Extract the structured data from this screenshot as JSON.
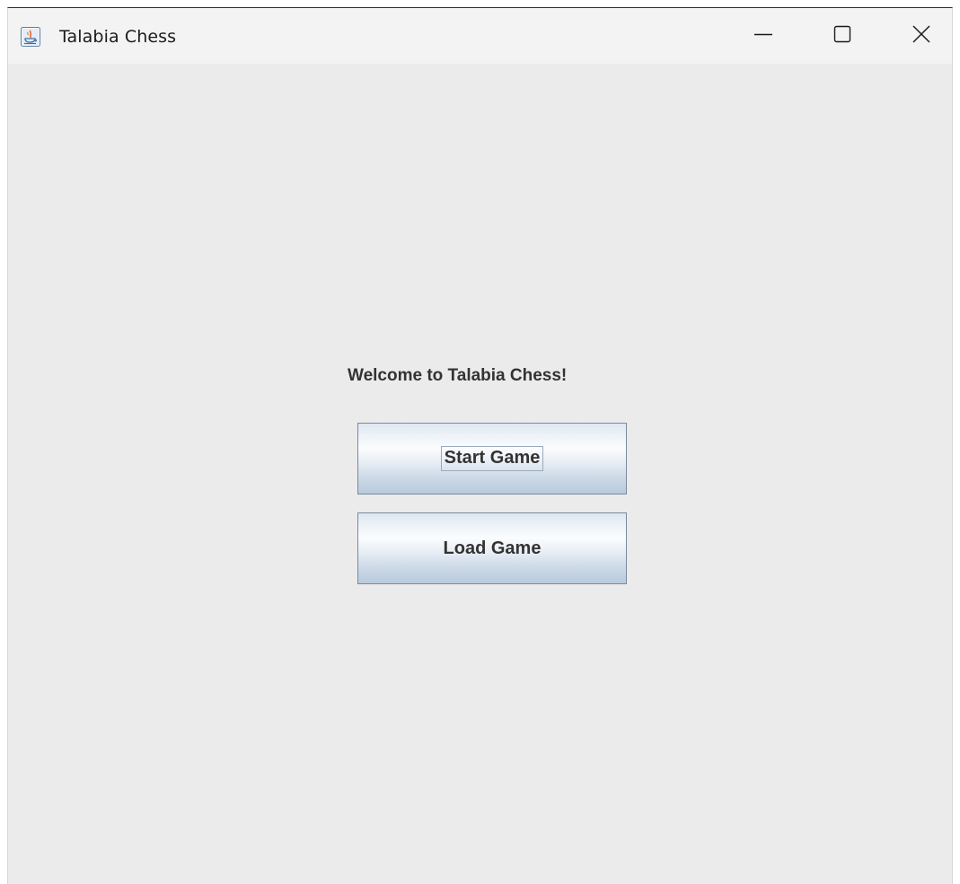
{
  "window": {
    "title": "Talabia Chess",
    "app_icon": "java-coffee-icon",
    "controls": {
      "minimize": "minimize-icon",
      "maximize": "maximize-icon",
      "close": "close-icon"
    }
  },
  "main": {
    "welcome_text": "Welcome to Talabia Chess!",
    "start_button_label": "Start Game",
    "load_button_label": "Load Game"
  },
  "colors": {
    "background": "#ebebeb",
    "titlebar": "#f3f3f3",
    "text": "#333333",
    "button_border": "#7a8a9e"
  }
}
